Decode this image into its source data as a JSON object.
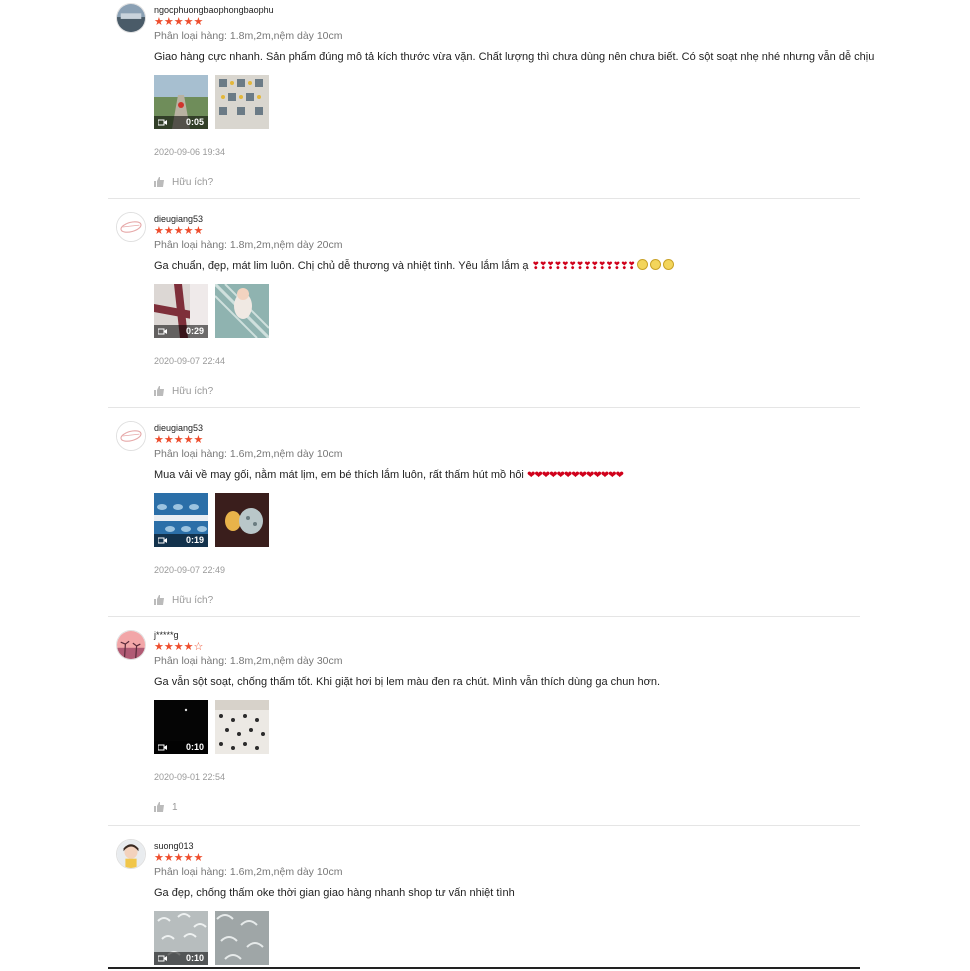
{
  "reviews": [
    {
      "username": "ngocphuongbaophongbaophu",
      "rating": 5,
      "variant": "Phân loại hàng: 1.8m,2m,nệm dày 10cm",
      "comment": "Giao hàng cực nhanh. Sản phẩm đúng mô tả kích thước vừa vặn. Chất lượng thì chưa dùng nên chưa biết. Có sột soạt nhẹ nhé nhưng vẫn dễ chịu",
      "hearts": "",
      "emojis": 0,
      "video_duration": "0:05",
      "timestamp": "2020-09-06 19:34",
      "helpful": "Hữu ích?"
    },
    {
      "username": "dieugiang53",
      "rating": 5,
      "variant": "Phân loại hàng: 1.8m,2m,nệm dày 20cm",
      "comment": "Ga chuẩn, đẹp, mát lim luôn. Chị chủ dễ thương và nhiệt tình. Yêu lắm lắm ạ",
      "hearts": "❣❣❣❣❣❣❣❣❣❣❣❣❣❣",
      "emojis": 3,
      "video_duration": "0:29",
      "timestamp": "2020-09-07 22:44",
      "helpful": "Hữu ích?"
    },
    {
      "username": "dieugiang53",
      "rating": 5,
      "variant": "Phân loại hàng: 1.6m,2m,nệm dày 10cm",
      "comment": "Mua vải về may gối, nằm mát lịm, em bé thích lắm luôn, rất thấm hút mồ hôi",
      "hearts": "❤❤❤❤❤❤❤❤❤❤❤❤❤",
      "emojis": 0,
      "video_duration": "0:19",
      "timestamp": "2020-09-07 22:49",
      "helpful": "Hữu ích?"
    },
    {
      "username": "j*****g",
      "rating": 4,
      "variant": "Phân loại hàng: 1.8m,2m,nệm dày 30cm",
      "comment": "Ga vẫn sột soạt, chống thấm tốt. Khi giặt hơi bị lem màu đen ra chút. Mình vẫn thích dùng ga chun hơn.",
      "hearts": "",
      "emojis": 0,
      "video_duration": "0:10",
      "timestamp": "2020-09-01 22:54",
      "helpful": "1"
    },
    {
      "username": "suong013",
      "rating": 5,
      "variant": "Phân loại hàng: 1.6m,2m,nệm dày 10cm",
      "comment": "Ga đẹp, chống thấm oke thời gian giao hàng nhanh shop tư vấn nhiệt tình",
      "hearts": "",
      "emojis": 0,
      "video_duration": "0:10",
      "timestamp": "",
      "helpful": ""
    }
  ],
  "colors": {
    "star": "#ee4d2d",
    "text": "#222222",
    "muted": "#999999",
    "heart": "#d0011b"
  }
}
